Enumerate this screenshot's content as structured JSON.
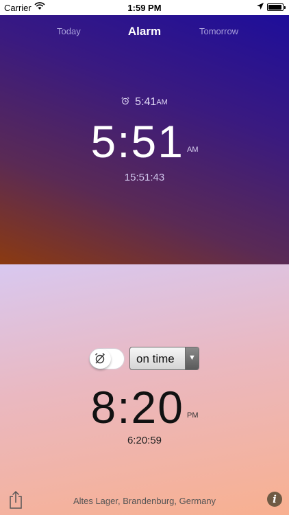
{
  "status_bar": {
    "carrier": "Carrier",
    "time": "1:59 PM"
  },
  "tabs": {
    "today": "Today",
    "alarm": "Alarm",
    "tomorrow": "Tomorrow"
  },
  "top": {
    "alarm_time": "5:41",
    "alarm_ampm": "AM",
    "big_time": "5:51",
    "big_ampm": "AM",
    "seconds_time": "15:51:43"
  },
  "bottom": {
    "mode_option": "on time",
    "big_time": "8:20",
    "big_ampm": "PM",
    "seconds_time": "6:20:59"
  },
  "footer": {
    "location": "Altes Lager, Brandenburg, Germany",
    "info_label": "i"
  },
  "colors": {
    "top_gradient": [
      "#8b3a10",
      "#5a2a55",
      "#3a1a80",
      "#1e0e9a"
    ],
    "bottom_gradient": [
      "#d8c8f0",
      "#eab8c0",
      "#f8b090"
    ]
  },
  "icons": [
    "wifi-icon",
    "location-arrow-icon",
    "battery-icon",
    "alarm-clock-icon",
    "alarm-off-icon",
    "dropdown-arrow-icon",
    "share-icon",
    "info-icon"
  ]
}
